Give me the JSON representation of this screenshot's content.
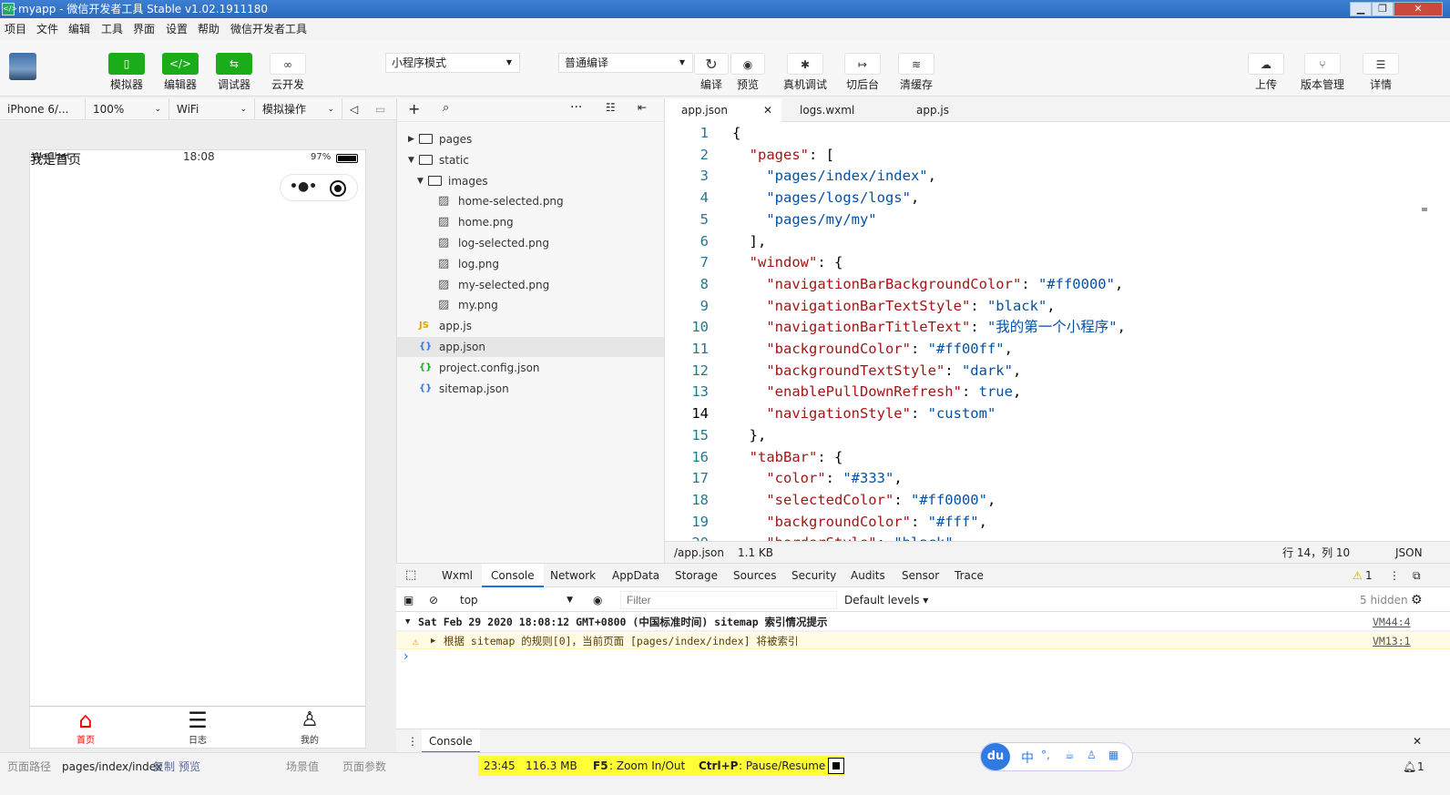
{
  "window": {
    "title": "myapp - 微信开发者工具 Stable v1.02.1911180",
    "minimize": "▁",
    "restore": "❐",
    "close": "✕"
  },
  "menu": [
    "项目",
    "文件",
    "编辑",
    "工具",
    "界面",
    "设置",
    "帮助",
    "微信开发者工具"
  ],
  "toolbar": {
    "left_buttons": [
      {
        "label": "模拟器",
        "icon": "phone-icon",
        "glyph": "▯"
      },
      {
        "label": "编辑器",
        "icon": "code-icon",
        "glyph": "</>"
      },
      {
        "label": "调试器",
        "icon": "debug-icon",
        "glyph": "⇆"
      },
      {
        "label": "云开发",
        "icon": "cloud-link-icon",
        "glyph": "∞"
      }
    ],
    "mode_select": "小程序模式",
    "compile_select": "普通编译",
    "mid_buttons": [
      {
        "label": "编译",
        "icon": "refresh-icon",
        "glyph": "↻"
      },
      {
        "label": "预览",
        "icon": "eye-icon",
        "glyph": "◉"
      },
      {
        "label": "真机调试",
        "icon": "bug-icon",
        "glyph": "✱"
      },
      {
        "label": "切后台",
        "icon": "switch-background-icon",
        "glyph": "↦"
      },
      {
        "label": "清缓存",
        "icon": "layers-icon",
        "glyph": "≋"
      }
    ],
    "right_buttons": [
      {
        "label": "上传",
        "icon": "upload-icon",
        "glyph": "☁"
      },
      {
        "label": "版本管理",
        "icon": "version-icon",
        "glyph": "⑂"
      },
      {
        "label": "详情",
        "icon": "menu-icon",
        "glyph": "☰"
      }
    ]
  },
  "simulator": {
    "device": "iPhone 6/...",
    "zoom": "100%",
    "network": "WiFi",
    "ops": "模拟操作",
    "statusbar": {
      "carrier": "WeChat",
      "time": "18:08",
      "battery": "97%"
    },
    "page_title": "我是首页",
    "tabbar": [
      {
        "label": "首页",
        "icon": "home-icon",
        "active": true
      },
      {
        "label": "日志",
        "icon": "list-icon",
        "active": false
      },
      {
        "label": "我的",
        "icon": "user-icon",
        "active": false
      }
    ],
    "accent": "#ff0000"
  },
  "tree": [
    {
      "label": "pages",
      "type": "folder",
      "depth": 0,
      "expanded": false
    },
    {
      "label": "static",
      "type": "folder",
      "depth": 0,
      "expanded": true
    },
    {
      "label": "images",
      "type": "folder",
      "depth": 1,
      "expanded": true
    },
    {
      "label": "home-selected.png",
      "type": "image",
      "depth": 2
    },
    {
      "label": "home.png",
      "type": "image",
      "depth": 2
    },
    {
      "label": "log-selected.png",
      "type": "image",
      "depth": 2
    },
    {
      "label": "log.png",
      "type": "image",
      "depth": 2
    },
    {
      "label": "my-selected.png",
      "type": "image",
      "depth": 2
    },
    {
      "label": "my.png",
      "type": "image",
      "depth": 2
    },
    {
      "label": "app.js",
      "type": "js",
      "depth": 0
    },
    {
      "label": "app.json",
      "type": "json",
      "depth": 0,
      "active": true
    },
    {
      "label": "project.config.json",
      "type": "config",
      "depth": 0
    },
    {
      "label": "sitemap.json",
      "type": "json",
      "depth": 0
    }
  ],
  "editor": {
    "tabs": [
      {
        "label": "app.json",
        "active": true
      },
      {
        "label": "logs.wxml",
        "active": false
      },
      {
        "label": "app.js",
        "active": false
      }
    ],
    "lines": [
      [
        [
          "p",
          "{"
        ]
      ],
      [
        [
          "p",
          "  "
        ],
        [
          "k",
          "\"pages\""
        ],
        [
          "p",
          ": ["
        ]
      ],
      [
        [
          "p",
          "    "
        ],
        [
          "s",
          "\"pages/index/index\""
        ],
        [
          "p",
          ","
        ]
      ],
      [
        [
          "p",
          "    "
        ],
        [
          "s",
          "\"pages/logs/logs\""
        ],
        [
          "p",
          ","
        ]
      ],
      [
        [
          "p",
          "    "
        ],
        [
          "s",
          "\"pages/my/my\""
        ]
      ],
      [
        [
          "p",
          "  ],"
        ]
      ],
      [
        [
          "p",
          "  "
        ],
        [
          "k",
          "\"window\""
        ],
        [
          "p",
          ": {"
        ]
      ],
      [
        [
          "p",
          "    "
        ],
        [
          "k",
          "\"navigationBarBackgroundColor\""
        ],
        [
          "p",
          ": "
        ],
        [
          "s",
          "\"#ff0000\""
        ],
        [
          "p",
          ","
        ]
      ],
      [
        [
          "p",
          "    "
        ],
        [
          "k",
          "\"navigationBarTextStyle\""
        ],
        [
          "p",
          ": "
        ],
        [
          "s",
          "\"black\""
        ],
        [
          "p",
          ","
        ]
      ],
      [
        [
          "p",
          "    "
        ],
        [
          "k",
          "\"navigationBarTitleText\""
        ],
        [
          "p",
          ": "
        ],
        [
          "s",
          "\"我的第一个小程序\""
        ],
        [
          "p",
          ","
        ]
      ],
      [
        [
          "p",
          "    "
        ],
        [
          "k",
          "\"backgroundColor\""
        ],
        [
          "p",
          ": "
        ],
        [
          "s",
          "\"#ff00ff\""
        ],
        [
          "p",
          ","
        ]
      ],
      [
        [
          "p",
          "    "
        ],
        [
          "k",
          "\"backgroundTextStyle\""
        ],
        [
          "p",
          ": "
        ],
        [
          "s",
          "\"dark\""
        ],
        [
          "p",
          ","
        ]
      ],
      [
        [
          "p",
          "    "
        ],
        [
          "k",
          "\"enablePullDownRefresh\""
        ],
        [
          "p",
          ": "
        ],
        [
          "b",
          "true"
        ],
        [
          "p",
          ","
        ]
      ],
      [
        [
          "p",
          "    "
        ],
        [
          "k",
          "\"navigationStyle\""
        ],
        [
          "p",
          ": "
        ],
        [
          "s",
          "\"custom\""
        ]
      ],
      [
        [
          "p",
          "  },"
        ]
      ],
      [
        [
          "p",
          "  "
        ],
        [
          "k",
          "\"tabBar\""
        ],
        [
          "p",
          ": {"
        ]
      ],
      [
        [
          "p",
          "    "
        ],
        [
          "k",
          "\"color\""
        ],
        [
          "p",
          ": "
        ],
        [
          "s",
          "\"#333\""
        ],
        [
          "p",
          ","
        ]
      ],
      [
        [
          "p",
          "    "
        ],
        [
          "k",
          "\"selectedColor\""
        ],
        [
          "p",
          ": "
        ],
        [
          "s",
          "\"#ff0000\""
        ],
        [
          "p",
          ","
        ]
      ],
      [
        [
          "p",
          "    "
        ],
        [
          "k",
          "\"backgroundColor\""
        ],
        [
          "p",
          ": "
        ],
        [
          "s",
          "\"#fff\""
        ],
        [
          "p",
          ","
        ]
      ],
      [
        [
          "p",
          "    "
        ],
        [
          "k",
          "\"borderStyle\""
        ],
        [
          "p",
          ": "
        ],
        [
          "s",
          "\"black\""
        ]
      ]
    ],
    "status": {
      "path": "/app.json",
      "size": "1.1 KB",
      "position": "行 14，列 10",
      "lang": "JSON"
    }
  },
  "devtools": {
    "tabs": [
      "Wxml",
      "Console",
      "Network",
      "AppData",
      "Storage",
      "Sources",
      "Security",
      "Audits",
      "Sensor",
      "Trace"
    ],
    "active_tab": "Console",
    "warn_count": "1",
    "context": "top",
    "filter_placeholder": "Filter",
    "levels": "Default levels",
    "hidden": "5 hidden",
    "group_line": "Sat Feb 29 2020 18:08:12 GMT+0800 (中国标准时间) sitemap 索引情况提示",
    "group_src": "VM44:4",
    "warn_line": "根据 sitemap 的规则[0]，当前页面 [pages/index/index] 将被索引",
    "warn_src": "VM13:1",
    "prompt": "›",
    "drawer_tab": "Console"
  },
  "footer": {
    "path_label": "页面路径",
    "path": "pages/index/index",
    "copy": "复制",
    "preview": "预览",
    "scene": "场景值",
    "params": "页面参数",
    "count": "1"
  },
  "recorder": {
    "time": "23:45",
    "mem": "116.3 MB",
    "f5": "F5",
    "f5_text": ": Zoom In/Out",
    "ctrlp": "Ctrl+P",
    "ctrlp_text": ": Pause/Resume"
  },
  "ime": {
    "logo": "du",
    "lang": "中",
    "punct": "°,"
  }
}
